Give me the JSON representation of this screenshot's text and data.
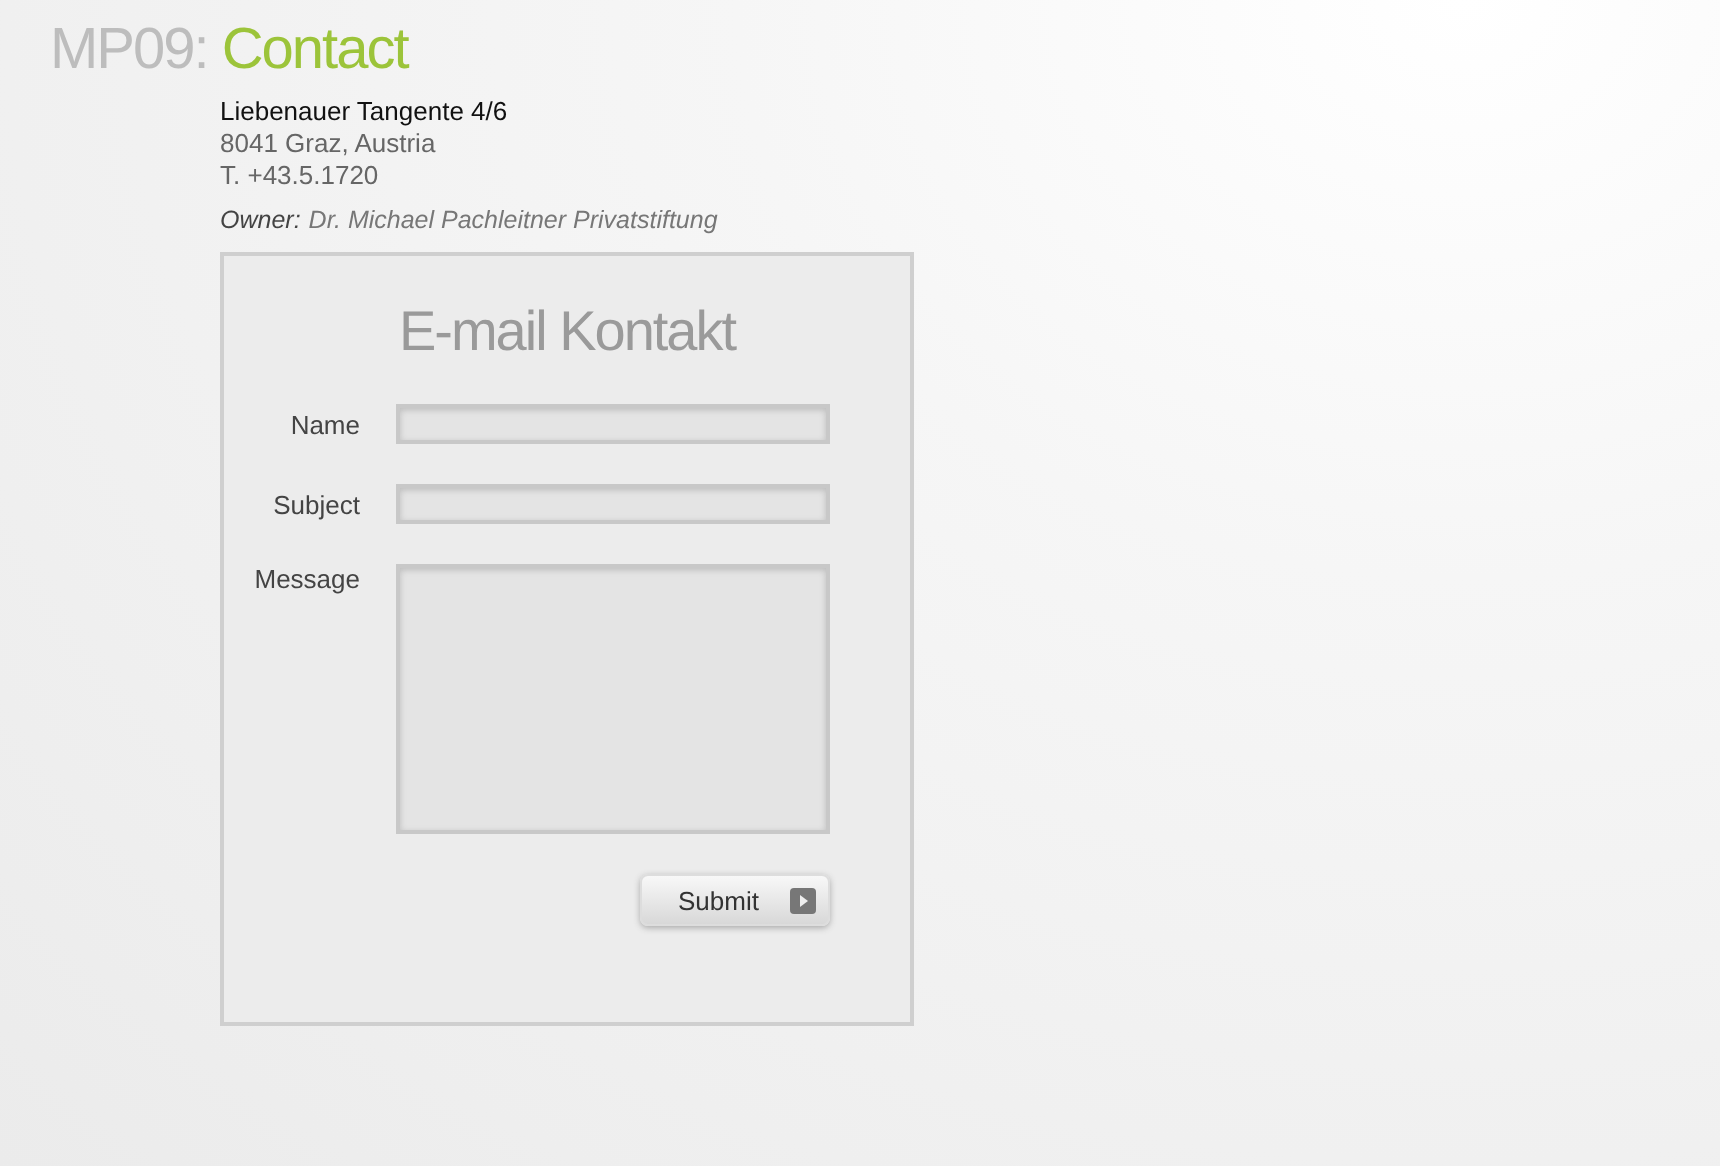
{
  "title": {
    "code": "MP09:",
    "page": "Contact"
  },
  "address": {
    "street": "Liebenauer Tangente 4/6",
    "city": "8041 Graz, Austria",
    "phone": "T. +43.5.1720"
  },
  "owner": {
    "label": "Owner:",
    "value": "Dr. Michael Pachleitner Privatstiftung"
  },
  "form": {
    "heading": "E-mail Kontakt",
    "fields": [
      {
        "label": "Name",
        "kind": "line"
      },
      {
        "label": "Subject",
        "kind": "line"
      },
      {
        "label": "Message",
        "kind": "area"
      }
    ],
    "submit": "Submit"
  }
}
